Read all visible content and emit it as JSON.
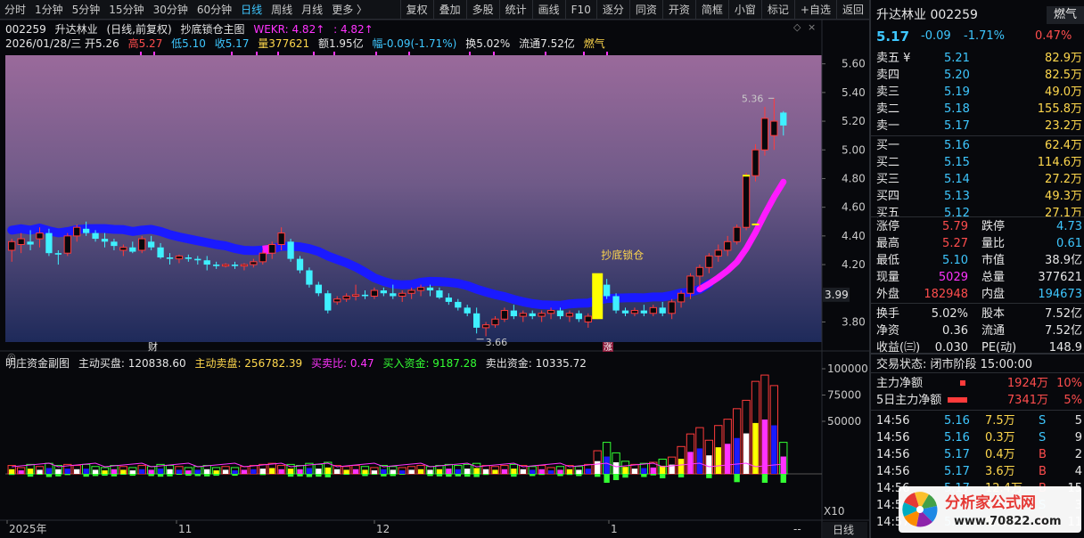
{
  "toolbar": {
    "left_items": [
      "分时",
      "1分钟",
      "5分钟",
      "15分钟",
      "30分钟",
      "60分钟",
      "日线",
      "周线",
      "月线",
      "更多 〉"
    ],
    "active_index": 6,
    "right_items": [
      "复权",
      "叠加",
      "多股",
      "统计",
      "画线",
      "F10",
      "逐分",
      "同资",
      "开资",
      "简框",
      "小窗",
      "标记",
      "+自选",
      "返回"
    ]
  },
  "header": {
    "code": "002259",
    "name": "升达林业",
    "period": "(日线,前复权)",
    "indicator": "抄底锁仓主图",
    "wekr_label": "WEKR: 4.82↑",
    "wekr_value": ": 4.82↑"
  },
  "info": {
    "date": "2026/01/28/三",
    "open": "开5.26",
    "high": "高5.27",
    "low": "低5.10",
    "close": "收5.17",
    "volume": "量377621",
    "amount": "额1.95亿",
    "change": "幅-0.09(-1.71%)",
    "turnover": "换5.02%",
    "float_cap": "流通7.52亿",
    "tag": "燃气"
  },
  "price_axis": [
    "5.60",
    "5.40",
    "5.20",
    "5.00",
    "4.80",
    "4.60",
    "4.40",
    "4.20",
    "3.99",
    "3.80"
  ],
  "annotations": {
    "max_label": "5.36",
    "min_label": "3.66",
    "signal_label": "抄底锁仓",
    "fin_marker": "财",
    "rise_marker": "涨"
  },
  "sub": {
    "title": "明庄资金副图",
    "active_buy": "主动买盘: 120838.60",
    "active_sell": "主动卖盘: 256782.39",
    "buy_sell_ratio": "买卖比: 0.47",
    "buy_funds": "买入资金: 9187.28",
    "sell_funds": "卖出资金: 10335.72",
    "axis": [
      "100000",
      "75000",
      "50000"
    ],
    "scale": "X10"
  },
  "x_axis": [
    "2025年",
    "11",
    "12",
    "1"
  ],
  "x_end": "--",
  "period_tab": "日线",
  "cursor_price": "3.99",
  "chart_data": {
    "type": "candlestick",
    "ylim": [
      3.66,
      5.66
    ],
    "candles": [
      [
        4.3,
        4.38,
        4.22,
        4.36
      ],
      [
        4.34,
        4.42,
        4.28,
        4.38
      ],
      [
        4.36,
        4.44,
        4.3,
        4.34
      ],
      [
        4.38,
        4.46,
        4.32,
        4.42
      ],
      [
        4.42,
        4.45,
        4.26,
        4.28
      ],
      [
        4.28,
        4.3,
        4.2,
        4.27
      ],
      [
        4.28,
        4.42,
        4.26,
        4.4
      ],
      [
        4.4,
        4.48,
        4.36,
        4.46
      ],
      [
        4.45,
        4.5,
        4.4,
        4.42
      ],
      [
        4.42,
        4.44,
        4.36,
        4.38
      ],
      [
        4.38,
        4.42,
        4.32,
        4.36
      ],
      [
        4.36,
        4.38,
        4.3,
        4.33
      ],
      [
        4.3,
        4.34,
        4.26,
        4.32
      ],
      [
        4.32,
        4.36,
        4.28,
        4.29
      ],
      [
        4.3,
        4.4,
        4.28,
        4.38
      ],
      [
        4.36,
        4.4,
        4.3,
        4.32
      ],
      [
        4.32,
        4.35,
        4.24,
        4.25
      ],
      [
        4.25,
        4.28,
        4.2,
        4.24
      ],
      [
        4.24,
        4.27,
        4.21,
        4.26
      ],
      [
        4.25,
        4.27,
        4.22,
        4.24
      ],
      [
        4.24,
        4.26,
        4.2,
        4.23
      ],
      [
        4.23,
        4.26,
        4.16,
        4.2
      ],
      [
        4.2,
        4.22,
        4.17,
        4.19
      ],
      [
        4.19,
        4.21,
        4.18,
        4.2
      ],
      [
        4.2,
        4.22,
        4.17,
        4.19
      ],
      [
        4.19,
        4.21,
        4.16,
        4.2
      ],
      [
        4.2,
        4.24,
        4.18,
        4.22
      ],
      [
        4.22,
        4.3,
        4.2,
        4.28
      ],
      [
        4.28,
        4.36,
        4.24,
        4.34
      ],
      [
        4.34,
        4.46,
        4.3,
        4.42
      ],
      [
        4.36,
        4.38,
        4.22,
        4.24
      ],
      [
        4.24,
        4.26,
        4.14,
        4.16
      ],
      [
        4.16,
        4.18,
        4.04,
        4.06
      ],
      [
        4.06,
        4.08,
        3.98,
        4.0
      ],
      [
        4.0,
        4.02,
        3.86,
        3.88
      ],
      [
        3.94,
        3.98,
        3.92,
        3.96
      ],
      [
        3.96,
        4.0,
        3.94,
        3.98
      ],
      [
        3.98,
        4.06,
        3.95,
        3.99
      ],
      [
        3.99,
        4.02,
        3.96,
        3.98
      ],
      [
        3.98,
        4.04,
        3.96,
        4.02
      ],
      [
        4.02,
        4.04,
        3.98,
        4.0
      ],
      [
        4.0,
        4.06,
        3.96,
        3.98
      ],
      [
        3.98,
        4.02,
        3.94,
        4.0
      ],
      [
        4.0,
        4.04,
        3.96,
        4.02
      ],
      [
        4.02,
        4.06,
        3.98,
        4.04
      ],
      [
        4.04,
        4.06,
        3.98,
        4.02
      ],
      [
        4.02,
        4.04,
        3.96,
        3.97
      ],
      [
        3.97,
        4.0,
        3.92,
        3.94
      ],
      [
        3.94,
        3.96,
        3.88,
        3.9
      ],
      [
        3.9,
        3.92,
        3.84,
        3.86
      ],
      [
        3.86,
        3.9,
        3.72,
        3.76
      ],
      [
        3.76,
        3.8,
        3.7,
        3.78
      ],
      [
        3.78,
        3.84,
        3.76,
        3.82
      ],
      [
        3.82,
        3.9,
        3.8,
        3.88
      ],
      [
        3.88,
        3.92,
        3.82,
        3.84
      ],
      [
        3.84,
        3.88,
        3.8,
        3.86
      ],
      [
        3.86,
        3.88,
        3.82,
        3.84
      ],
      [
        3.84,
        3.88,
        3.8,
        3.86
      ],
      [
        3.86,
        3.9,
        3.82,
        3.88
      ],
      [
        3.88,
        3.9,
        3.82,
        3.84
      ],
      [
        3.84,
        3.88,
        3.8,
        3.86
      ],
      [
        3.86,
        3.88,
        3.8,
        3.82
      ],
      [
        3.8,
        3.86,
        3.76,
        3.84
      ],
      [
        3.84,
        4.1,
        3.82,
        4.06
      ],
      [
        4.06,
        4.1,
        3.96,
        3.98
      ],
      [
        3.98,
        4.0,
        3.86,
        3.88
      ],
      [
        3.88,
        3.9,
        3.84,
        3.86
      ],
      [
        3.86,
        3.9,
        3.84,
        3.88
      ],
      [
        3.88,
        3.92,
        3.84,
        3.86
      ],
      [
        3.86,
        3.92,
        3.84,
        3.9
      ],
      [
        3.9,
        3.94,
        3.84,
        3.86
      ],
      [
        3.86,
        3.96,
        3.82,
        3.94
      ],
      [
        3.94,
        4.02,
        3.9,
        4.0
      ],
      [
        4.0,
        4.14,
        3.96,
        4.12
      ],
      [
        4.12,
        4.2,
        4.04,
        4.18
      ],
      [
        4.18,
        4.28,
        4.14,
        4.26
      ],
      [
        4.26,
        4.34,
        4.22,
        4.3
      ],
      [
        4.3,
        4.4,
        4.26,
        4.36
      ],
      [
        4.36,
        4.48,
        4.34,
        4.46
      ],
      [
        4.46,
        4.84,
        4.44,
        4.82
      ],
      [
        4.82,
        5.04,
        4.78,
        5.0
      ],
      [
        5.0,
        5.3,
        4.96,
        5.22
      ],
      [
        5.1,
        5.36,
        5.0,
        5.2
      ],
      [
        5.26,
        5.27,
        5.1,
        5.17
      ]
    ],
    "volume": [
      8,
      6,
      9,
      7,
      10,
      8,
      9,
      8,
      9,
      7,
      6,
      8,
      7,
      6,
      8,
      7,
      9,
      8,
      7,
      6,
      7,
      8,
      6,
      7,
      6,
      7,
      8,
      9,
      10,
      8,
      9,
      8,
      10,
      9,
      11,
      8,
      7,
      8,
      7,
      6,
      8,
      7,
      6,
      7,
      8,
      7,
      8,
      9,
      8,
      9,
      10,
      8,
      7,
      8,
      9,
      8,
      7,
      8,
      6,
      7,
      8,
      7,
      9,
      22,
      30,
      20,
      12,
      9,
      10,
      11,
      14,
      16,
      26,
      38,
      44,
      32,
      46,
      52,
      62,
      70,
      88,
      94,
      84,
      30
    ]
  }
}
